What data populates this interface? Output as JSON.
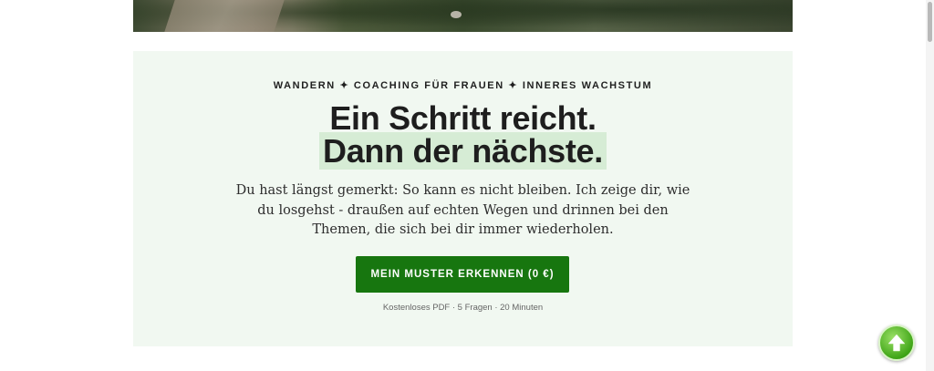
{
  "hero": {
    "image_label": "Wanderweg"
  },
  "card": {
    "eyebrow": "WANDERN ✦ COACHING FÜR FRAUEN ✦ INNERES WACHSTUM",
    "headline_line1": "Ein Schritt reicht.",
    "headline_line2": "Dann der nächste.",
    "lead": "Du hast längst gemerkt: So kann es nicht bleiben. Ich zeige dir, wie du losgehst - draußen auf echten Wegen und drinnen bei den Themen, die sich bei dir immer wiederholen.",
    "cta_label": "MEIN MUSTER ERKENNEN (0 €)",
    "meta": "Kostenloses PDF · 5 Fragen · 20 Minuten"
  },
  "scroll_top": {
    "icon": "arrow-up-icon"
  },
  "colors": {
    "accent": "#17760f",
    "card_bg": "#f1f8f1",
    "highlight": "#d6ecd5"
  }
}
